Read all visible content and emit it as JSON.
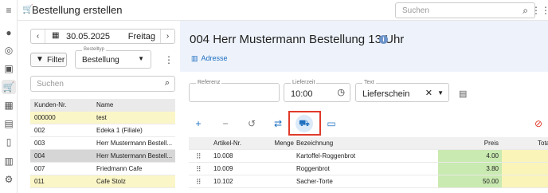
{
  "topbar": {
    "title": "Bestellung erstellen",
    "title_icon": "cart-plus-icon",
    "search_placeholder": "Suchen"
  },
  "rail": {
    "icons": [
      "menu-icon",
      "person-icon",
      "face-scan-icon",
      "briefcase-icon",
      "cart-icon",
      "factory-icon",
      "cash-icon",
      "clipboard-icon",
      "chart-icon",
      "settings-icon"
    ],
    "active": "cart-icon"
  },
  "left": {
    "date": "30.05.2025",
    "weekday": "Freitag",
    "filter_label": "Filter",
    "ordertype_label": "Bestelltyp",
    "ordertype_value": "Bestellung",
    "search_placeholder": "Suchen",
    "table": {
      "headers": [
        "Kunden-Nr.",
        "Name"
      ],
      "rows": [
        {
          "nr": "000000",
          "name": "test",
          "style": "yellow"
        },
        {
          "nr": "002",
          "name": "Edeka 1 (Filiale)",
          "style": "normal"
        },
        {
          "nr": "003",
          "name": "Herr Mustermann Bestell...",
          "style": "normal"
        },
        {
          "nr": "004",
          "name": "Herr Mustermann Bestell...",
          "style": "selected"
        },
        {
          "nr": "007",
          "name": "Friedmann Cafe",
          "style": "normal"
        },
        {
          "nr": "011",
          "name": "Cafe Stolz",
          "style": "yellow"
        }
      ]
    }
  },
  "main": {
    "title": "004 Herr Mustermann Bestellung 13 Uhr",
    "address_label": "Adresse",
    "fields": {
      "referenz_label": "Referenz",
      "referenz_value": "",
      "lieferzeit_label": "Lieferzeit",
      "lieferzeit_value": "10:00",
      "text_label": "Text",
      "text_value": "Lieferschein"
    },
    "toolbar": [
      "add-icon",
      "remove-icon",
      "history-icon",
      "swap-icon",
      "truck-icon",
      "keyboard-icon",
      "cancel-icon"
    ],
    "table": {
      "headers": {
        "nr": "Artikel-Nr.",
        "menge": "Menge",
        "bez": "Bezeichnung",
        "preis": "Preis",
        "total": "Total"
      },
      "rows": [
        {
          "nr": "10.008",
          "menge": "",
          "bez": "Kartoffel-Roggenbrot",
          "preis": "4.00"
        },
        {
          "nr": "10.009",
          "menge": "",
          "bez": "Roggenbrot",
          "preis": "3.80"
        },
        {
          "nr": "10.102",
          "menge": "",
          "bez": "Sacher-Torte",
          "preis": "50.00"
        }
      ]
    }
  },
  "colors": {
    "accent": "#1e6fc0",
    "header_bg": "#eef3fb",
    "row_yellow": "#fbf6c7",
    "price_green": "#c9eab0",
    "highlight_red": "#e03a2a"
  }
}
